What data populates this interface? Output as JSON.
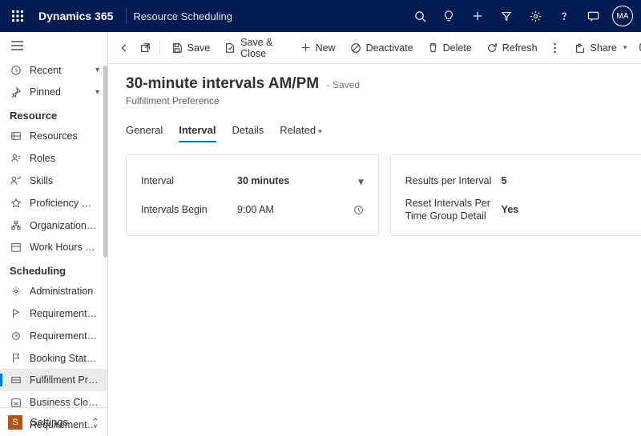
{
  "topbar": {
    "brand": "Dynamics 365",
    "module": "Resource Scheduling",
    "avatar": "MA"
  },
  "sidebar": {
    "recent": "Recent",
    "pinned": "Pinned",
    "section1": "Resource",
    "items1": [
      {
        "label": "Resources"
      },
      {
        "label": "Roles"
      },
      {
        "label": "Skills"
      },
      {
        "label": "Proficiency Models"
      },
      {
        "label": "Organizational Un..."
      },
      {
        "label": "Work Hours Temp..."
      }
    ],
    "section2": "Scheduling",
    "items2": [
      {
        "label": "Administration"
      },
      {
        "label": "Requirement Prior..."
      },
      {
        "label": "Requirement Stat..."
      },
      {
        "label": "Booking Statuses"
      },
      {
        "label": "Fulfillment Prefer...",
        "selected": true
      },
      {
        "label": "Business Closures"
      },
      {
        "label": "Requirement Gro..."
      }
    ],
    "footer": {
      "badge": "S",
      "label": "Settings"
    }
  },
  "commands": {
    "save": "Save",
    "saveclose": "Save & Close",
    "new": "New",
    "deactivate": "Deactivate",
    "delete": "Delete",
    "refresh": "Refresh",
    "share": "Share"
  },
  "record": {
    "title": "30-minute intervals AM/PM",
    "state": "- Saved",
    "entity": "Fulfillment Preference"
  },
  "tabs": [
    {
      "label": "General"
    },
    {
      "label": "Interval",
      "active": true
    },
    {
      "label": "Details"
    },
    {
      "label": "Related",
      "chevron": true
    }
  ],
  "form": {
    "interval_label": "Interval",
    "interval_value": "30 minutes",
    "begin_label": "Intervals Begin",
    "begin_value": "9:00 AM",
    "rpi_label": "Results per Interval",
    "rpi_value": "5",
    "reset_label": "Reset Intervals Per Time Group Detail",
    "reset_value": "Yes"
  }
}
